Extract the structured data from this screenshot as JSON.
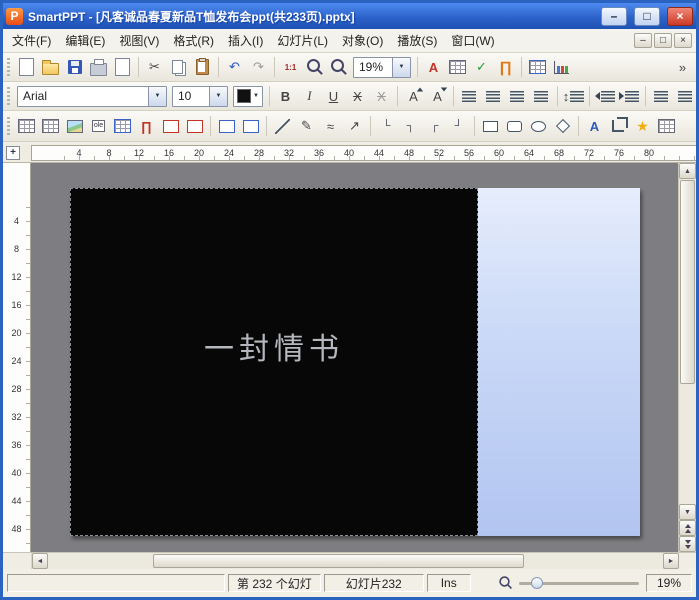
{
  "window": {
    "title": "SmartPPT - [凡客诚品春夏新品T恤发布会ppt(共233页).pptx]",
    "app_name": "SmartPPT"
  },
  "glyphs": {
    "app_logo_letter": "P",
    "minimize": "–",
    "maximize": "□",
    "restore": "□",
    "close": "×",
    "cut": "✂",
    "undo": "↶",
    "redo": "↷",
    "actual_size": "1:1",
    "letter_a": "A",
    "check": "✓",
    "pi": "∏",
    "bold": "B",
    "italic": "I",
    "underline": "U",
    "strike": "X",
    "updown": "↕",
    "pencil": "✎",
    "curve": "≈",
    "arrow": "↗",
    "conn_elbow_1": "└",
    "conn_elbow_2": "┐",
    "conn_elbow_3": "┌",
    "conn_elbow_4": "┘",
    "star": "★",
    "ole_label": "ole",
    "more": "»",
    "up_arrow": "▲",
    "down_arrow": "▼",
    "left_arrow": "◄",
    "right_arrow": "►",
    "corner_cross": "+",
    "dropdown_arrow": "▼"
  },
  "menu": {
    "items": [
      {
        "label": "文件(F)"
      },
      {
        "label": "编辑(E)"
      },
      {
        "label": "视图(V)"
      },
      {
        "label": "格式(R)"
      },
      {
        "label": "插入(I)"
      },
      {
        "label": "幻灯片(L)"
      },
      {
        "label": "对象(O)"
      },
      {
        "label": "播放(S)"
      },
      {
        "label": "窗口(W)"
      }
    ]
  },
  "toolbar_main": {
    "zoom_value": "19%"
  },
  "toolbar_format": {
    "font_name": "Arial",
    "font_size": "10"
  },
  "ruler": {
    "h_ticks": [
      "4",
      "8",
      "12",
      "16",
      "20",
      "24",
      "28",
      "32",
      "36",
      "40",
      "44",
      "48",
      "52",
      "56",
      "60",
      "64",
      "68",
      "72",
      "76",
      "80"
    ],
    "v_ticks": [
      "4",
      "8",
      "12",
      "16",
      "20",
      "24",
      "28",
      "32",
      "36",
      "40",
      "44",
      "48"
    ]
  },
  "slide": {
    "text": "一封情书"
  },
  "statusbar": {
    "slide_position": "第 232 个幻灯",
    "slide_name": "幻灯片232",
    "insert_mode": "Ins",
    "zoom_percent": "19%"
  },
  "colors": {
    "titlebar_blue": "#2a60c8",
    "slide_black": "#070707",
    "slide_panel_blue": "#c9d8f7",
    "canvas_gray": "#7e7e82",
    "accent_red": "#c23428"
  }
}
